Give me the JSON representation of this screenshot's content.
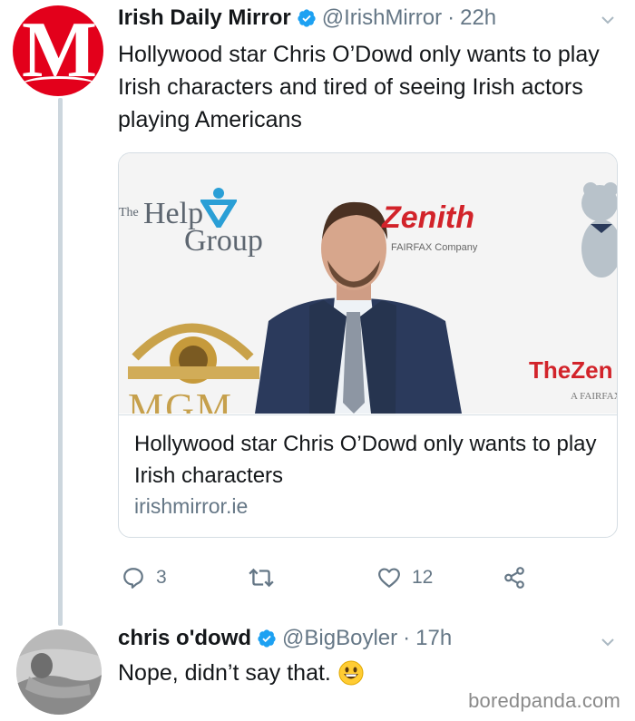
{
  "tweet": {
    "author_name": "Irish Daily Mirror",
    "author_handle": "@IrishMirror",
    "separator": "·",
    "time": "22h",
    "avatar_letter": "M",
    "text": "Hollywood star Chris O’Dowd only wants to play Irish characters and tired of seeing Irish actors playing Americans",
    "card": {
      "title": "Hollywood star Chris O’Dowd only wants to play Irish characters",
      "domain": "irishmirror.ie",
      "backdrop_logos": {
        "help_group_the": "The",
        "help_group_help": "Help",
        "help_group_group": "Group",
        "zenith": "Zenith",
        "fairfax_company": "FAIRFAX Company",
        "mgm": "MGM",
        "the_zenith": "TheZen",
        "a_fairfax": "A FAIRFAX"
      }
    },
    "actions": {
      "reply_count": "3",
      "retweet_count": "",
      "like_count": "12"
    }
  },
  "reply": {
    "author_name": "chris o'dowd",
    "author_handle": "@BigBoyler",
    "separator": "·",
    "time": "17h",
    "text": "Nope, didn’t say that."
  },
  "watermark": "boredpanda.com",
  "colors": {
    "verified_blue": "#1da1f2",
    "secondary_text": "#657786",
    "mirror_red": "#e3001b",
    "zenith_red": "#d2232a"
  }
}
